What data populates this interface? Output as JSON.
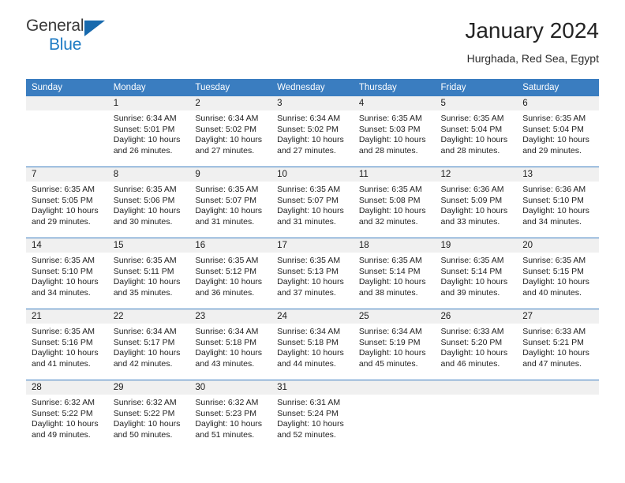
{
  "brand": {
    "name_part1": "General",
    "name_part2": "Blue",
    "triangle_icon": "triangle-icon",
    "accent_color": "#1c7ac4"
  },
  "header": {
    "title": "January 2024",
    "subtitle": "Hurghada, Red Sea, Egypt"
  },
  "theme": {
    "header_bg": "#3a7dc0",
    "daynum_bg": "#f0f0f0",
    "grid_line": "#3a7dc0",
    "text": "#1f1f1f"
  },
  "weekday_headers": [
    "Sunday",
    "Monday",
    "Tuesday",
    "Wednesday",
    "Thursday",
    "Friday",
    "Saturday"
  ],
  "labels": {
    "sunrise_prefix": "Sunrise:",
    "sunset_prefix": "Sunset:",
    "daylight_prefix": "Daylight:"
  },
  "weeks": [
    {
      "days": [
        {
          "day": "",
          "line1": "",
          "line2": "",
          "line3": "",
          "line4": "",
          "empty": true
        },
        {
          "day": "1",
          "line1": "Sunrise: 6:34 AM",
          "line2": "Sunset: 5:01 PM",
          "line3": "Daylight: 10 hours",
          "line4": "and 26 minutes.",
          "empty": false
        },
        {
          "day": "2",
          "line1": "Sunrise: 6:34 AM",
          "line2": "Sunset: 5:02 PM",
          "line3": "Daylight: 10 hours",
          "line4": "and 27 minutes.",
          "empty": false
        },
        {
          "day": "3",
          "line1": "Sunrise: 6:34 AM",
          "line2": "Sunset: 5:02 PM",
          "line3": "Daylight: 10 hours",
          "line4": "and 27 minutes.",
          "empty": false
        },
        {
          "day": "4",
          "line1": "Sunrise: 6:35 AM",
          "line2": "Sunset: 5:03 PM",
          "line3": "Daylight: 10 hours",
          "line4": "and 28 minutes.",
          "empty": false
        },
        {
          "day": "5",
          "line1": "Sunrise: 6:35 AM",
          "line2": "Sunset: 5:04 PM",
          "line3": "Daylight: 10 hours",
          "line4": "and 28 minutes.",
          "empty": false
        },
        {
          "day": "6",
          "line1": "Sunrise: 6:35 AM",
          "line2": "Sunset: 5:04 PM",
          "line3": "Daylight: 10 hours",
          "line4": "and 29 minutes.",
          "empty": false
        }
      ]
    },
    {
      "days": [
        {
          "day": "7",
          "line1": "Sunrise: 6:35 AM",
          "line2": "Sunset: 5:05 PM",
          "line3": "Daylight: 10 hours",
          "line4": "and 29 minutes.",
          "empty": false
        },
        {
          "day": "8",
          "line1": "Sunrise: 6:35 AM",
          "line2": "Sunset: 5:06 PM",
          "line3": "Daylight: 10 hours",
          "line4": "and 30 minutes.",
          "empty": false
        },
        {
          "day": "9",
          "line1": "Sunrise: 6:35 AM",
          "line2": "Sunset: 5:07 PM",
          "line3": "Daylight: 10 hours",
          "line4": "and 31 minutes.",
          "empty": false
        },
        {
          "day": "10",
          "line1": "Sunrise: 6:35 AM",
          "line2": "Sunset: 5:07 PM",
          "line3": "Daylight: 10 hours",
          "line4": "and 31 minutes.",
          "empty": false
        },
        {
          "day": "11",
          "line1": "Sunrise: 6:35 AM",
          "line2": "Sunset: 5:08 PM",
          "line3": "Daylight: 10 hours",
          "line4": "and 32 minutes.",
          "empty": false
        },
        {
          "day": "12",
          "line1": "Sunrise: 6:36 AM",
          "line2": "Sunset: 5:09 PM",
          "line3": "Daylight: 10 hours",
          "line4": "and 33 minutes.",
          "empty": false
        },
        {
          "day": "13",
          "line1": "Sunrise: 6:36 AM",
          "line2": "Sunset: 5:10 PM",
          "line3": "Daylight: 10 hours",
          "line4": "and 34 minutes.",
          "empty": false
        }
      ]
    },
    {
      "days": [
        {
          "day": "14",
          "line1": "Sunrise: 6:35 AM",
          "line2": "Sunset: 5:10 PM",
          "line3": "Daylight: 10 hours",
          "line4": "and 34 minutes.",
          "empty": false
        },
        {
          "day": "15",
          "line1": "Sunrise: 6:35 AM",
          "line2": "Sunset: 5:11 PM",
          "line3": "Daylight: 10 hours",
          "line4": "and 35 minutes.",
          "empty": false
        },
        {
          "day": "16",
          "line1": "Sunrise: 6:35 AM",
          "line2": "Sunset: 5:12 PM",
          "line3": "Daylight: 10 hours",
          "line4": "and 36 minutes.",
          "empty": false
        },
        {
          "day": "17",
          "line1": "Sunrise: 6:35 AM",
          "line2": "Sunset: 5:13 PM",
          "line3": "Daylight: 10 hours",
          "line4": "and 37 minutes.",
          "empty": false
        },
        {
          "day": "18",
          "line1": "Sunrise: 6:35 AM",
          "line2": "Sunset: 5:14 PM",
          "line3": "Daylight: 10 hours",
          "line4": "and 38 minutes.",
          "empty": false
        },
        {
          "day": "19",
          "line1": "Sunrise: 6:35 AM",
          "line2": "Sunset: 5:14 PM",
          "line3": "Daylight: 10 hours",
          "line4": "and 39 minutes.",
          "empty": false
        },
        {
          "day": "20",
          "line1": "Sunrise: 6:35 AM",
          "line2": "Sunset: 5:15 PM",
          "line3": "Daylight: 10 hours",
          "line4": "and 40 minutes.",
          "empty": false
        }
      ]
    },
    {
      "days": [
        {
          "day": "21",
          "line1": "Sunrise: 6:35 AM",
          "line2": "Sunset: 5:16 PM",
          "line3": "Daylight: 10 hours",
          "line4": "and 41 minutes.",
          "empty": false
        },
        {
          "day": "22",
          "line1": "Sunrise: 6:34 AM",
          "line2": "Sunset: 5:17 PM",
          "line3": "Daylight: 10 hours",
          "line4": "and 42 minutes.",
          "empty": false
        },
        {
          "day": "23",
          "line1": "Sunrise: 6:34 AM",
          "line2": "Sunset: 5:18 PM",
          "line3": "Daylight: 10 hours",
          "line4": "and 43 minutes.",
          "empty": false
        },
        {
          "day": "24",
          "line1": "Sunrise: 6:34 AM",
          "line2": "Sunset: 5:18 PM",
          "line3": "Daylight: 10 hours",
          "line4": "and 44 minutes.",
          "empty": false
        },
        {
          "day": "25",
          "line1": "Sunrise: 6:34 AM",
          "line2": "Sunset: 5:19 PM",
          "line3": "Daylight: 10 hours",
          "line4": "and 45 minutes.",
          "empty": false
        },
        {
          "day": "26",
          "line1": "Sunrise: 6:33 AM",
          "line2": "Sunset: 5:20 PM",
          "line3": "Daylight: 10 hours",
          "line4": "and 46 minutes.",
          "empty": false
        },
        {
          "day": "27",
          "line1": "Sunrise: 6:33 AM",
          "line2": "Sunset: 5:21 PM",
          "line3": "Daylight: 10 hours",
          "line4": "and 47 minutes.",
          "empty": false
        }
      ]
    },
    {
      "days": [
        {
          "day": "28",
          "line1": "Sunrise: 6:32 AM",
          "line2": "Sunset: 5:22 PM",
          "line3": "Daylight: 10 hours",
          "line4": "and 49 minutes.",
          "empty": false
        },
        {
          "day": "29",
          "line1": "Sunrise: 6:32 AM",
          "line2": "Sunset: 5:22 PM",
          "line3": "Daylight: 10 hours",
          "line4": "and 50 minutes.",
          "empty": false
        },
        {
          "day": "30",
          "line1": "Sunrise: 6:32 AM",
          "line2": "Sunset: 5:23 PM",
          "line3": "Daylight: 10 hours",
          "line4": "and 51 minutes.",
          "empty": false
        },
        {
          "day": "31",
          "line1": "Sunrise: 6:31 AM",
          "line2": "Sunset: 5:24 PM",
          "line3": "Daylight: 10 hours",
          "line4": "and 52 minutes.",
          "empty": false
        },
        {
          "day": "",
          "line1": "",
          "line2": "",
          "line3": "",
          "line4": "",
          "empty": true
        },
        {
          "day": "",
          "line1": "",
          "line2": "",
          "line3": "",
          "line4": "",
          "empty": true
        },
        {
          "day": "",
          "line1": "",
          "line2": "",
          "line3": "",
          "line4": "",
          "empty": true
        }
      ]
    }
  ]
}
